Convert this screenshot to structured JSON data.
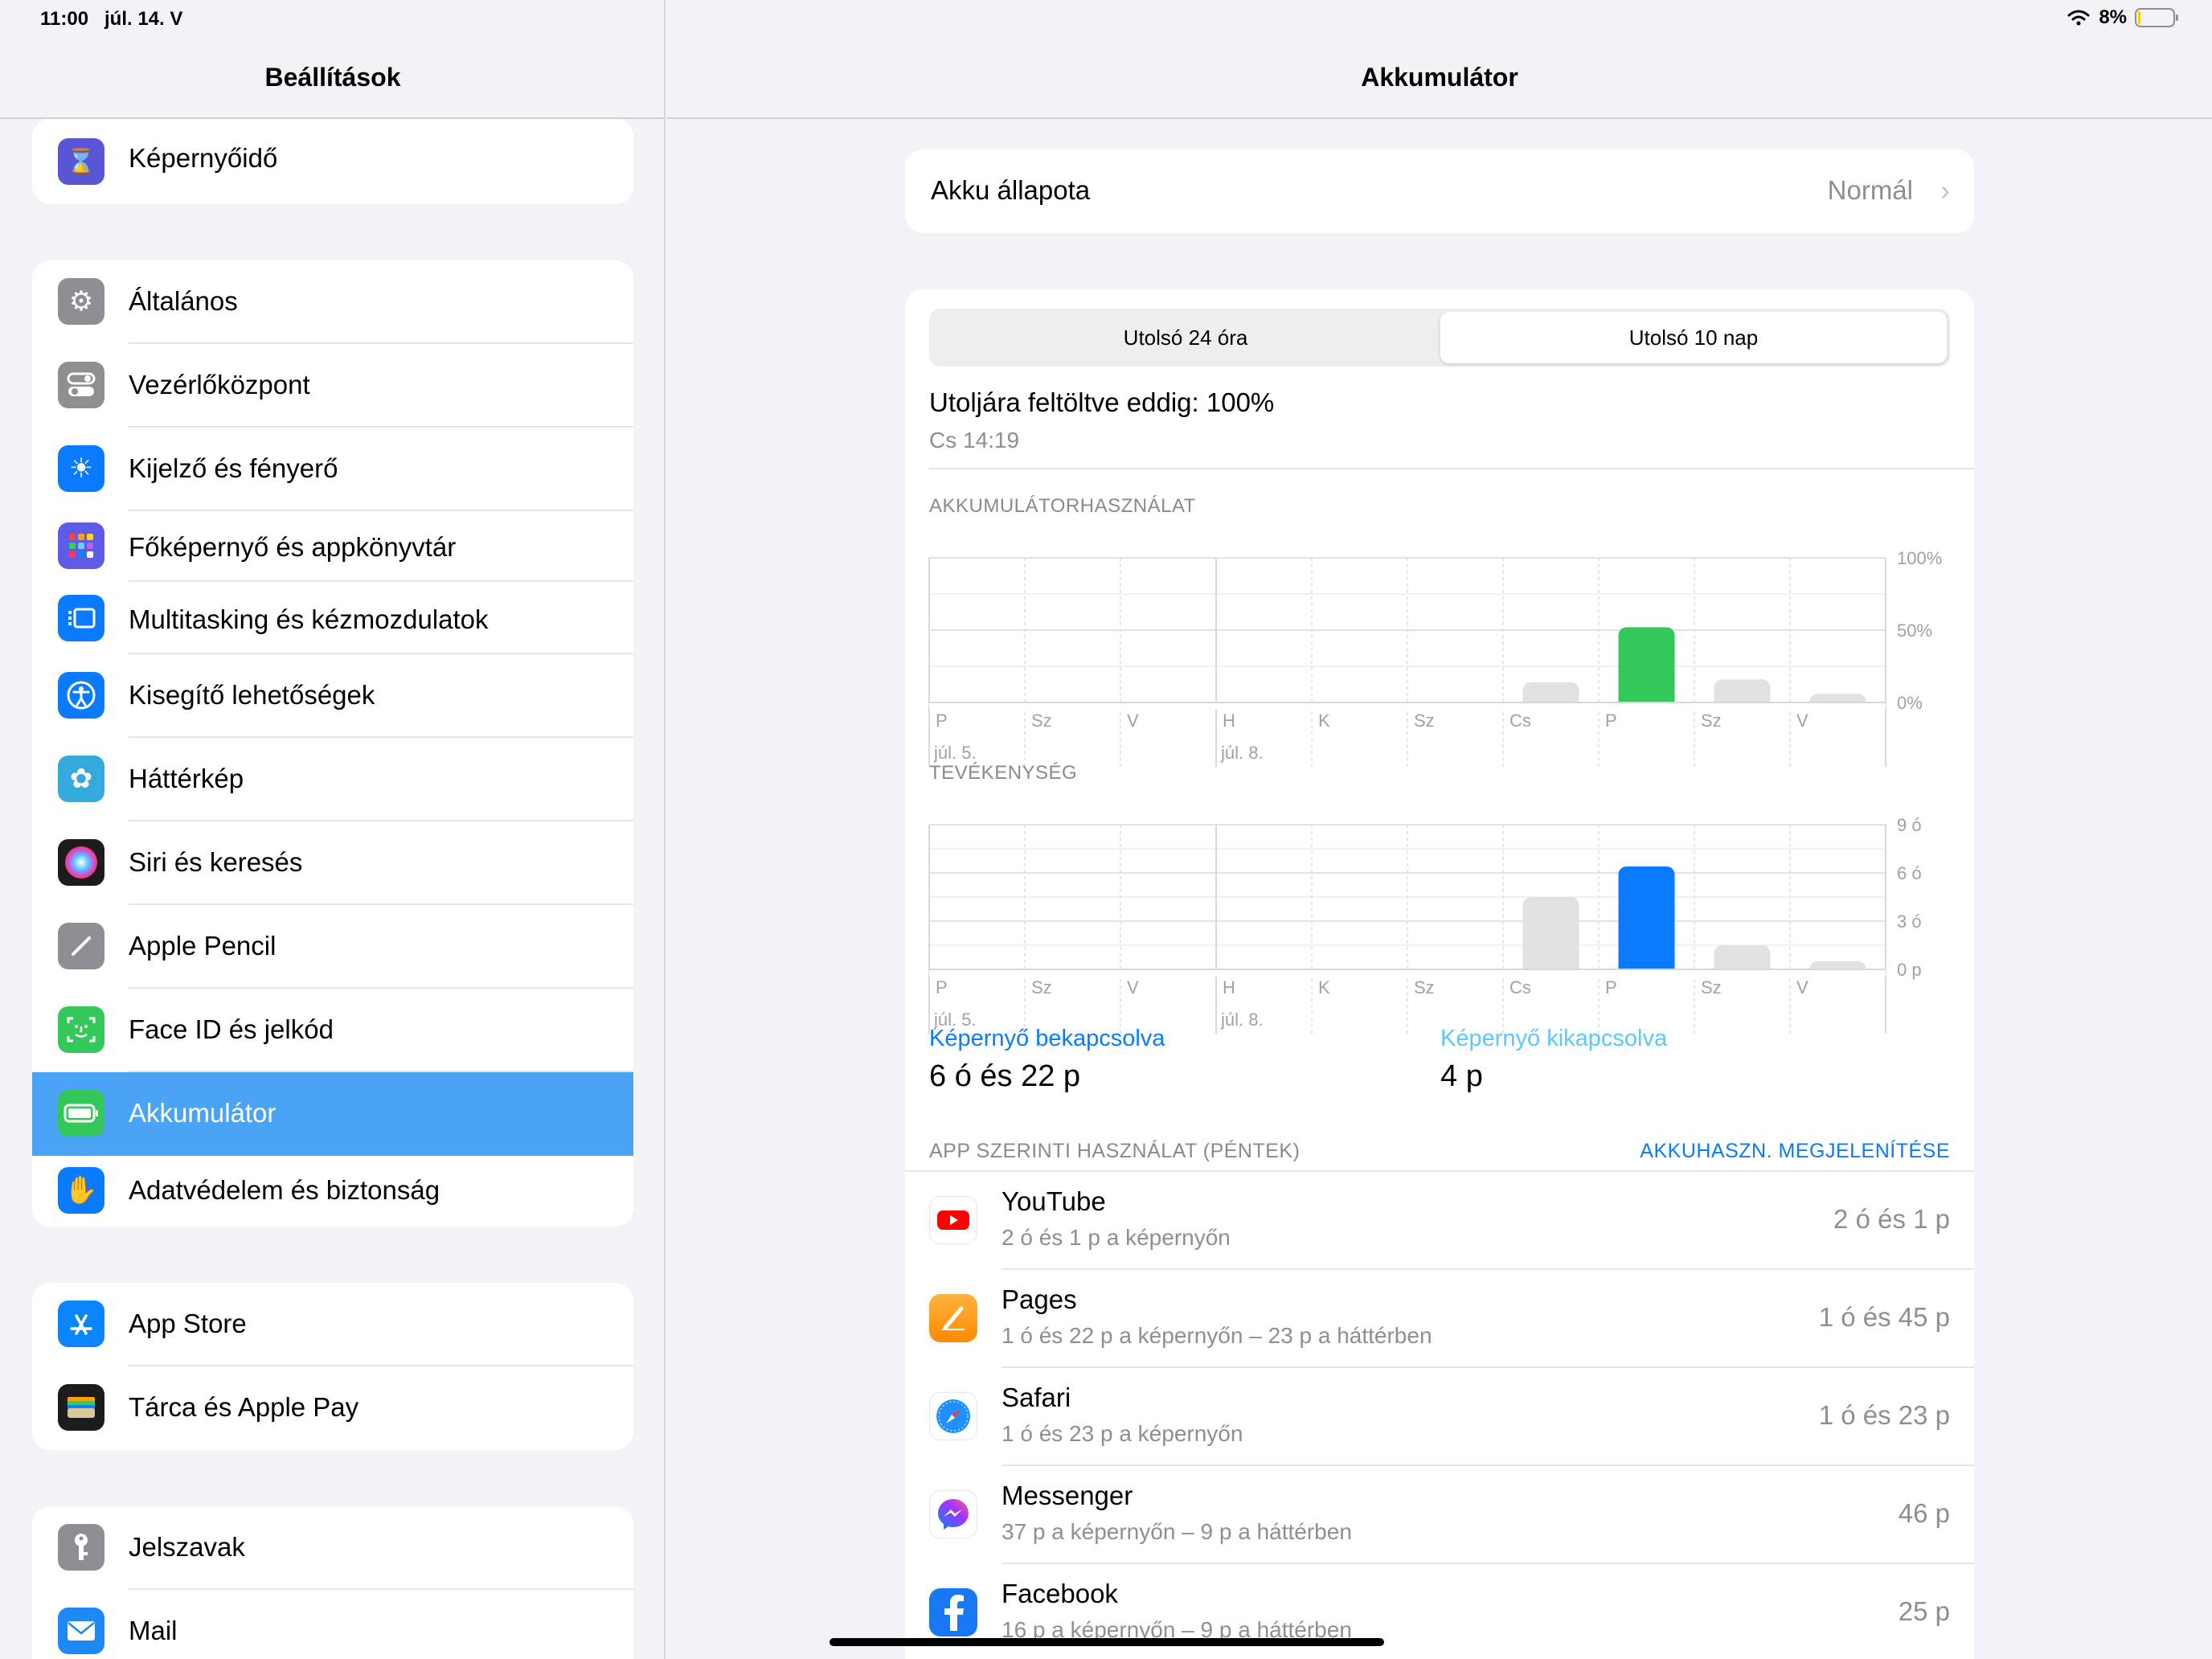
{
  "status": {
    "time": "11:00",
    "date": "júl. 14. V",
    "battery_pct": "8%",
    "battery_level": 0.08
  },
  "sidebar": {
    "title": "Beállítások",
    "groups": [
      {
        "items": [
          {
            "label": "Képernyőidő",
            "icon": "hourglass-icon",
            "color": "#5856d6"
          }
        ]
      },
      {
        "items": [
          {
            "label": "Általános",
            "icon": "gear-icon",
            "color": "#8e8e93"
          },
          {
            "label": "Vezérlőközpont",
            "icon": "toggles-icon",
            "color": "#8e8e93"
          },
          {
            "label": "Kijelző és fényerő",
            "icon": "sun-icon",
            "color": "#0a7aff"
          },
          {
            "label": "Főképernyő és appkönyvtár",
            "icon": "home-grid-icon",
            "color": "#5e5ce6"
          },
          {
            "label": "Multitasking és kézmozdulatok",
            "icon": "multitasking-icon",
            "color": "#0a7aff"
          },
          {
            "label": "Kisegítő lehetőségek",
            "icon": "accessibility-icon",
            "color": "#0a7aff"
          },
          {
            "label": "Háttérkép",
            "icon": "flower-icon",
            "color": "#34aadc"
          },
          {
            "label": "Siri és keresés",
            "icon": "siri-icon",
            "color": "#222222"
          },
          {
            "label": "Apple Pencil",
            "icon": "pencil-icon",
            "color": "#8e8e93"
          },
          {
            "label": "Face ID és jelkód",
            "icon": "faceid-icon",
            "color": "#34c759"
          },
          {
            "label": "Akkumulátor",
            "icon": "battery-icon",
            "color": "#34c759"
          },
          {
            "label": "Adatvédelem és biztonság",
            "icon": "hand-icon",
            "color": "#0a7aff"
          }
        ]
      },
      {
        "items": [
          {
            "label": "App Store",
            "icon": "appstore-icon",
            "color": "#0a84ff"
          },
          {
            "label": "Tárca és Apple Pay",
            "icon": "wallet-icon",
            "color": "#1c1c1e"
          }
        ]
      },
      {
        "items": [
          {
            "label": "Jelszavak",
            "icon": "key-icon",
            "color": "#8e8e93"
          },
          {
            "label": "Mail",
            "icon": "mail-icon",
            "color": "#1e88f5"
          }
        ]
      }
    ]
  },
  "detail": {
    "title": "Akkumulátor",
    "health": {
      "label": "Akku állapota",
      "value": "Normál"
    },
    "tabs": [
      "Utolsó 24 óra",
      "Utolsó 10 nap"
    ],
    "selected_tab": 1,
    "last_charged": {
      "label": "Utoljára feltöltve eddig: 100%",
      "time": "Cs 14:19"
    },
    "battery_section": "AKKUMULÁTORHASZNÁLAT",
    "activity_section": "TEVÉKENYSÉG",
    "screen_on": {
      "label": "Képernyő bekapcsolva",
      "value": "6 ó és 22 p"
    },
    "screen_off": {
      "label": "Képernyő kikapcsolva",
      "value": "4 p"
    },
    "apps_header": "APP SZERINTI HASZNÁLAT (PÉNTEK)",
    "apps_action": "AKKUHASZN. MEGJELENÍTÉSE",
    "apps": [
      {
        "name": "YouTube",
        "sub": "2 ó és 1 p a képernyőn",
        "time": "2 ó és 1 p",
        "icon": "youtube-icon"
      },
      {
        "name": "Pages",
        "sub": "1 ó és 22 p a képernyőn – 23 p a háttérben",
        "time": "1 ó és 45 p",
        "icon": "pages-icon"
      },
      {
        "name": "Safari",
        "sub": "1 ó és 23 p a képernyőn",
        "time": "1 ó és 23 p",
        "icon": "safari-icon"
      },
      {
        "name": "Messenger",
        "sub": "37 p a képernyőn – 9 p a háttérben",
        "time": "46 p",
        "icon": "messenger-icon"
      },
      {
        "name": "Facebook",
        "sub": "16 p a képernyőn – 9 p a háttérben",
        "time": "25 p",
        "icon": "facebook-icon"
      }
    ]
  },
  "chart_data": [
    {
      "type": "bar",
      "title": "AKKUMULÁTORHASZNÁLAT",
      "categories": [
        "P",
        "Sz",
        "V",
        "H",
        "K",
        "Sz",
        "Cs",
        "P",
        "Sz",
        "V"
      ],
      "date_labels": {
        "0": "júl. 5.",
        "3": "júl. 8."
      },
      "values": [
        0,
        0,
        0,
        0,
        0,
        0,
        14,
        52,
        16,
        6
      ],
      "highlight_index": 7,
      "yticks": [
        "100%",
        "50%",
        "0%"
      ],
      "ylim": [
        0,
        100
      ],
      "colors": {
        "highlight": "#34c759",
        "normal": "#e1e1e3"
      }
    },
    {
      "type": "bar",
      "title": "TEVÉKENYSÉG",
      "categories": [
        "P",
        "Sz",
        "V",
        "H",
        "K",
        "Sz",
        "Cs",
        "P",
        "Sz",
        "V"
      ],
      "date_labels": {
        "0": "júl. 5.",
        "3": "júl. 8."
      },
      "values": [
        0,
        0,
        0,
        0,
        0,
        0,
        4.5,
        6.4,
        1.5,
        0.5
      ],
      "highlight_index": 7,
      "yticks": [
        "9 ó",
        "6 ó",
        "3 ó",
        "0 p"
      ],
      "ylim": [
        0,
        9
      ],
      "colors": {
        "highlight": "#0a7aff",
        "normal": "#e1e1e3"
      }
    }
  ]
}
